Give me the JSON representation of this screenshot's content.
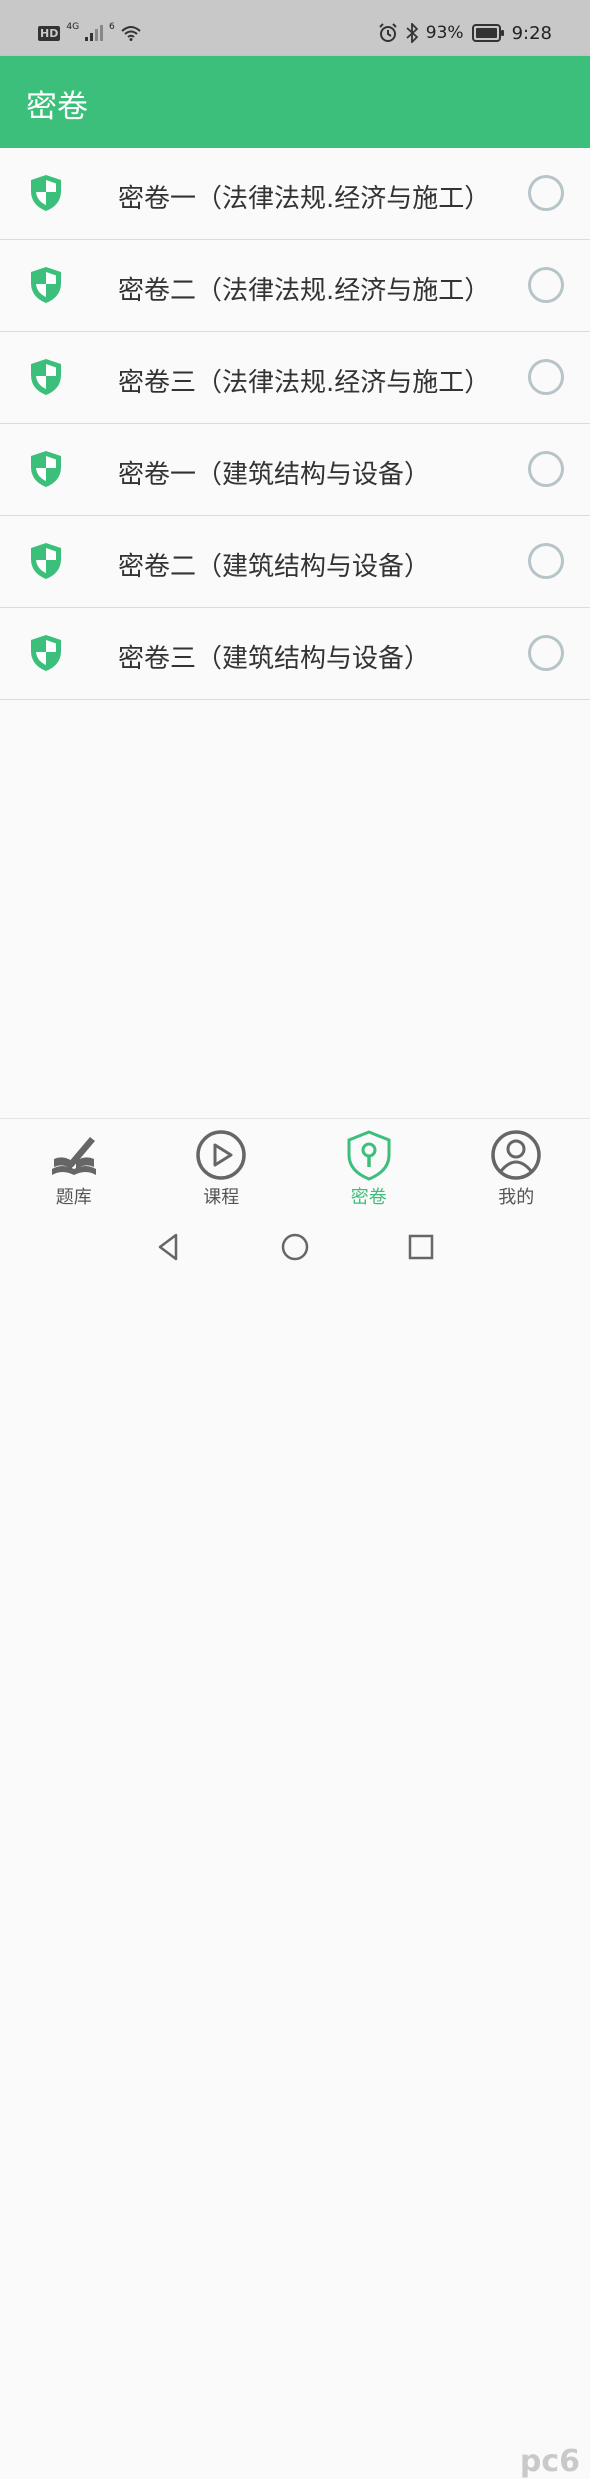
{
  "status_bar": {
    "network_badge": "HD",
    "signal_label": "4G",
    "wifi_label": "6",
    "battery": "93%",
    "time": "9:28"
  },
  "app_bar": {
    "title": "密卷"
  },
  "papers": [
    {
      "label": "密卷一（法律法规.经济与施工）",
      "selected": false
    },
    {
      "label": "密卷二（法律法规.经济与施工）",
      "selected": false
    },
    {
      "label": "密卷三（法律法规.经济与施工）",
      "selected": false
    },
    {
      "label": "密卷一（建筑结构与设备）",
      "selected": false
    },
    {
      "label": "密卷二（建筑结构与设备）",
      "selected": false
    },
    {
      "label": "密卷三（建筑结构与设备）",
      "selected": false
    }
  ],
  "tabs": [
    {
      "label": "题库",
      "icon": "book-pen-icon",
      "active": false
    },
    {
      "label": "课程",
      "icon": "play-circle-icon",
      "active": false
    },
    {
      "label": "密卷",
      "icon": "lock-shield-icon",
      "active": true
    },
    {
      "label": "我的",
      "icon": "person-circle-icon",
      "active": false
    }
  ],
  "nav_bar": {
    "back": "back-icon",
    "home": "home-icon",
    "recent": "recent-apps-icon"
  },
  "watermark": "pc6",
  "colors": {
    "accent": "#3cbf7a",
    "radio_border": "#b7c4c8",
    "status_bar": "#c8c8c8"
  }
}
